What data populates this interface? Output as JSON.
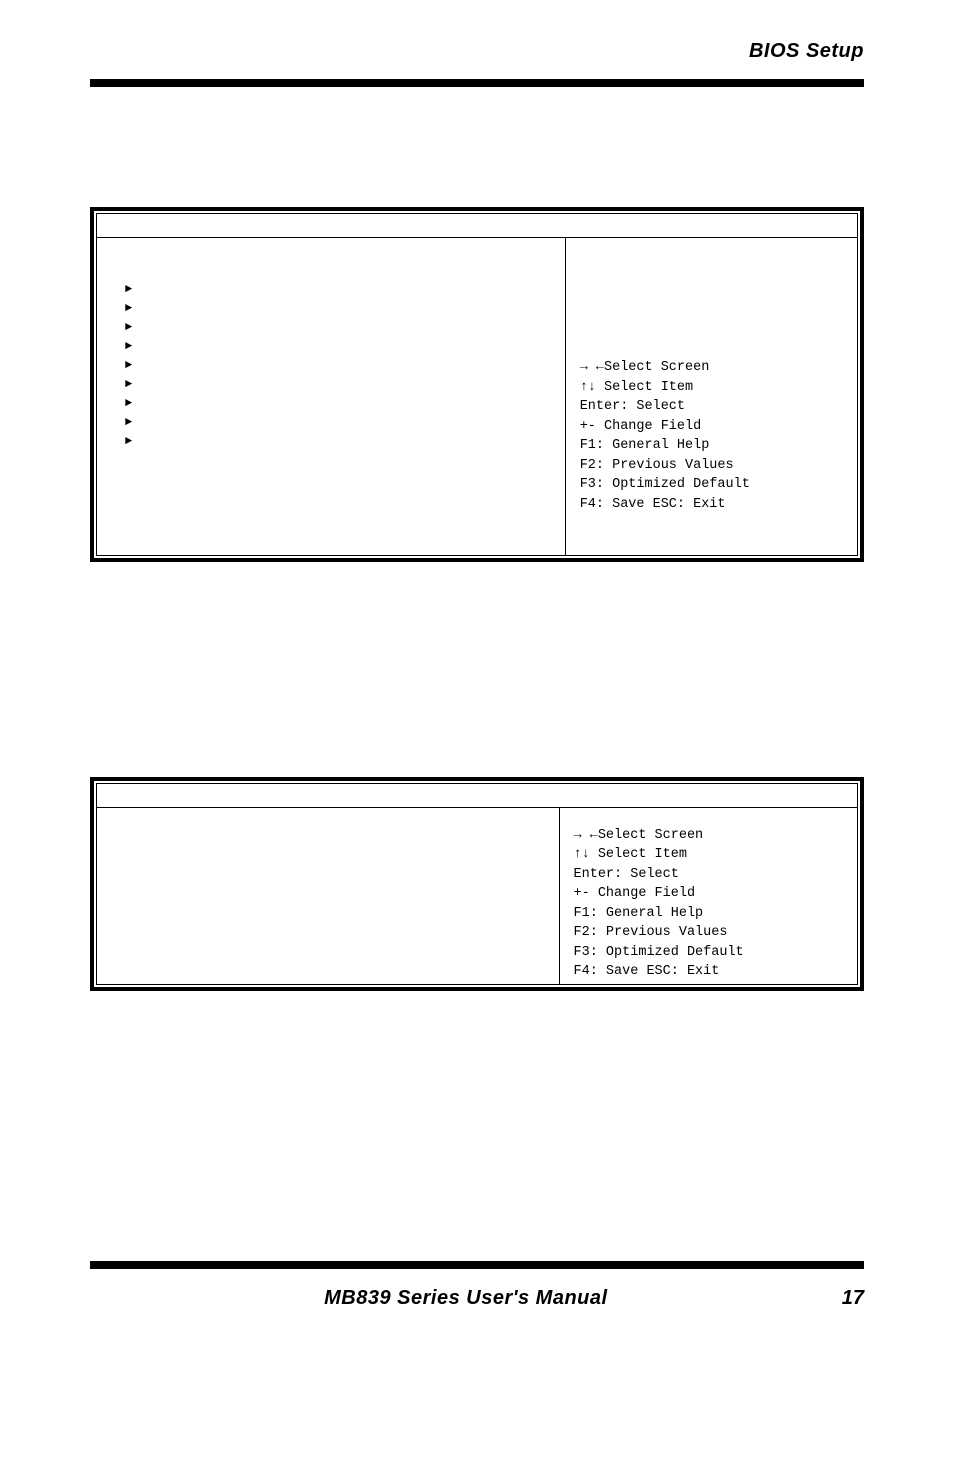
{
  "header": {
    "title": "BIOS Setup"
  },
  "box1": {
    "right": {
      "line1": "→ ←Select Screen",
      "line2": "↑↓ Select Item",
      "line3": "Enter: Select",
      "line4": "+-  Change Field",
      "line5": "F1: General Help",
      "line6": "F2: Previous Values",
      "line7": "F3: Optimized Default",
      "line8": "F4: Save  ESC: Exit"
    }
  },
  "box2": {
    "right": {
      "line1": "→ ←Select Screen",
      "line2": "↑↓ Select Item",
      "line3": "Enter: Select",
      "line4": "+-  Change Field",
      "line5": "F1: General Help",
      "line6": "F2: Previous Values",
      "line7": "F3: Optimized Default",
      "line8": "F4: Save  ESC: Exit"
    }
  },
  "footer": {
    "title": "MB839 Series User's Manual",
    "page": "17"
  }
}
